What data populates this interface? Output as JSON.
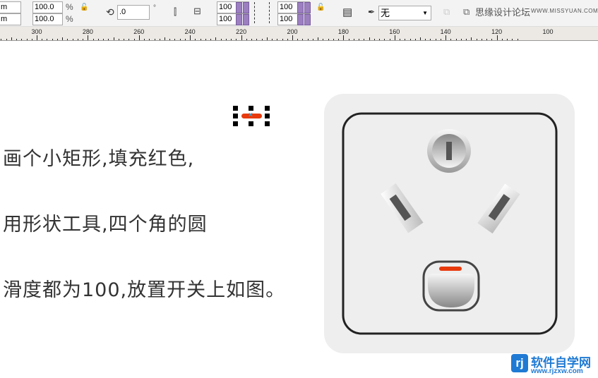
{
  "toolbar": {
    "size_w_suffix": "m",
    "size_h_suffix": "m",
    "scale_x": "100.0",
    "scale_y": "100.0",
    "percent": "%",
    "rotation": ".0",
    "degree": "°",
    "corner_tl": "100",
    "corner_bl": "100",
    "corner_tr": "100",
    "corner_br": "100",
    "outline_select": "无",
    "watermark": "思缘设计论坛",
    "watermark_url": "WWW.MISSYUAN.COM"
  },
  "ruler": {
    "labels": [
      "300",
      "280",
      "260",
      "240",
      "220",
      "200",
      "180",
      "160",
      "140",
      "120",
      "100"
    ]
  },
  "canvas": {
    "instruction_lines": [
      "画个小矩形,填充红色,",
      "用形状工具,四个角的圆",
      "滑度都为100,放置开关上如图。"
    ],
    "colors": {
      "red_rect": "#e83a0c",
      "socket_bg": "#eeeeee",
      "socket_border": "#222222"
    }
  },
  "footer_logo": {
    "brand": "软件自学网",
    "url": "www.rjzxw.com"
  }
}
